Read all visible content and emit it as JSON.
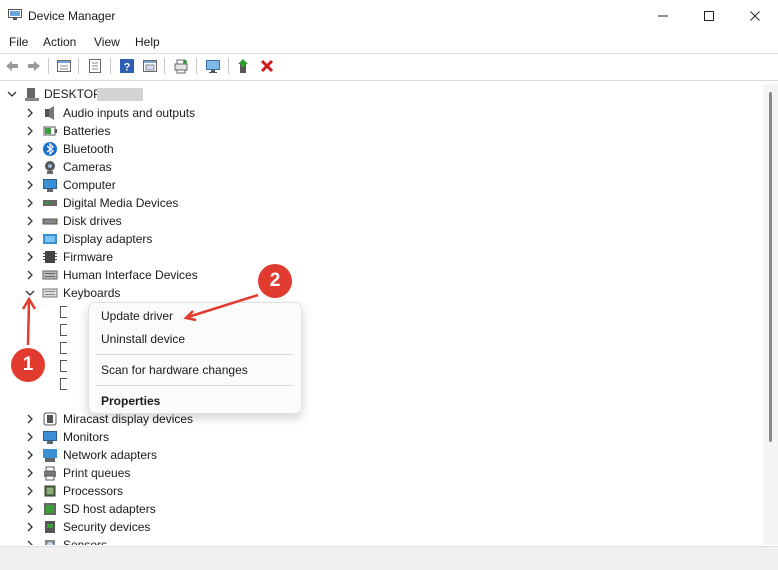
{
  "window": {
    "title": "Device Manager"
  },
  "menu": [
    "File",
    "Action",
    "View",
    "Help"
  ],
  "toolbar_icons": [
    "back-icon",
    "forward-icon",
    "properties-icon",
    "update-driver-icon",
    "help-icon",
    "view-icon",
    "scan-icon",
    "monitor-icon",
    "enable-device-icon",
    "uninstall-icon"
  ],
  "tree": {
    "root": "DESKTOP-",
    "categories": [
      {
        "label": "Audio inputs and outputs",
        "icon": "speaker-icon"
      },
      {
        "label": "Batteries",
        "icon": "battery-icon"
      },
      {
        "label": "Bluetooth",
        "icon": "bluetooth-icon"
      },
      {
        "label": "Cameras",
        "icon": "camera-icon"
      },
      {
        "label": "Computer",
        "icon": "computer-icon"
      },
      {
        "label": "Digital Media Devices",
        "icon": "media-device-icon"
      },
      {
        "label": "Disk drives",
        "icon": "disk-icon"
      },
      {
        "label": "Display adapters",
        "icon": "display-adapter-icon"
      },
      {
        "label": "Firmware",
        "icon": "firmware-icon"
      },
      {
        "label": "Human Interface Devices",
        "icon": "hid-icon"
      },
      {
        "label": "Keyboards",
        "icon": "keyboard-icon"
      },
      {
        "label": "Miracast display devices",
        "icon": "miracast-icon"
      },
      {
        "label": "Monitors",
        "icon": "monitor-icon"
      },
      {
        "label": "Network adapters",
        "icon": "network-icon"
      },
      {
        "label": "Print queues",
        "icon": "printer-icon"
      },
      {
        "label": "Processors",
        "icon": "processor-icon"
      },
      {
        "label": "SD host adapters",
        "icon": "sd-icon"
      },
      {
        "label": "Security devices",
        "icon": "security-icon"
      },
      {
        "label": "Sensors",
        "icon": "sensor-icon"
      }
    ]
  },
  "context_menu": {
    "update": "Update driver",
    "uninstall": "Uninstall device",
    "scan": "Scan for hardware changes",
    "properties": "Properties"
  },
  "annotations": {
    "badge1": "1",
    "badge2": "2"
  },
  "colors": {
    "badge": "#e03b2e",
    "accent": "#1e6fc8"
  }
}
